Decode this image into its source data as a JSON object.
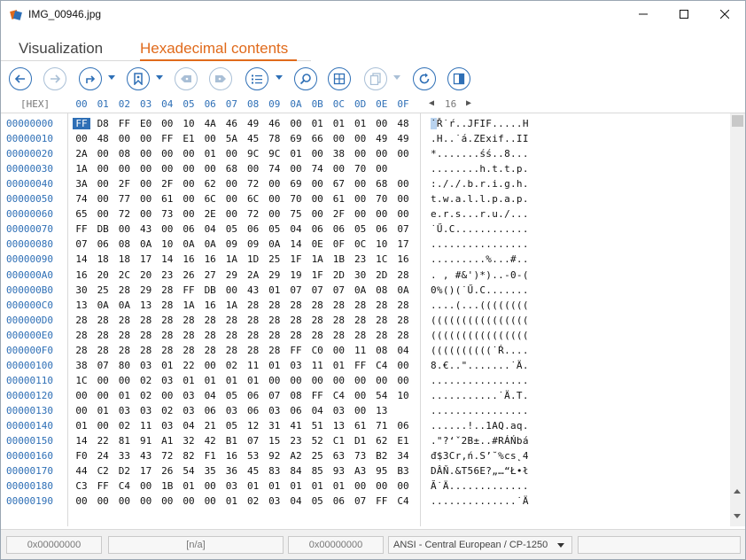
{
  "window": {
    "title": "IMG_00946.jpg"
  },
  "tabs": [
    {
      "label": "Visualization",
      "active": false
    },
    {
      "label": "Hexadecimal contents",
      "active": true
    }
  ],
  "colors": {
    "accent_orange": "#e06a1b",
    "accent_blue": "#2e6fb6",
    "selection": "#2e6fb6"
  },
  "toolbar": {
    "buttons": [
      {
        "name": "back-icon",
        "enabled": true
      },
      {
        "name": "forward-icon",
        "enabled": false
      },
      {
        "name": "redirect-icon",
        "enabled": true,
        "dropdown": true
      },
      {
        "name": "bookmark-icon",
        "enabled": true,
        "dropdown": true
      },
      {
        "name": "prev-bookmark-icon",
        "enabled": false
      },
      {
        "name": "next-bookmark-icon",
        "enabled": false
      },
      {
        "name": "list-icon",
        "enabled": true,
        "dropdown": true
      },
      {
        "name": "search-icon",
        "enabled": true
      },
      {
        "name": "grid-icon",
        "enabled": true
      },
      {
        "name": "copy-icon",
        "enabled": false,
        "dropdown": true
      },
      {
        "name": "refresh-icon",
        "enabled": true
      },
      {
        "name": "panel-icon",
        "enabled": true
      }
    ]
  },
  "hex": {
    "header_label": "[HEX]",
    "columns": [
      "00",
      "01",
      "02",
      "03",
      "04",
      "05",
      "06",
      "07",
      "08",
      "09",
      "0A",
      "0B",
      "0C",
      "0D",
      "0E",
      "0F"
    ],
    "page_number": "16",
    "selected_byte": {
      "row": 0,
      "col": 0
    },
    "rows": [
      {
        "offset": "00000000",
        "bytes": [
          "FF",
          "D8",
          "FF",
          "E0",
          "00",
          "10",
          "4A",
          "46",
          "49",
          "46",
          "00",
          "01",
          "01",
          "01",
          "00",
          "48"
        ],
        "text": "˙Ř˙ŕ..JFIF.....H"
      },
      {
        "offset": "00000010",
        "bytes": [
          "00",
          "48",
          "00",
          "00",
          "FF",
          "E1",
          "00",
          "5A",
          "45",
          "78",
          "69",
          "66",
          "00",
          "00",
          "49",
          "49"
        ],
        "text": ".H..˙á.ZExif..II"
      },
      {
        "offset": "00000020",
        "bytes": [
          "2A",
          "00",
          "08",
          "00",
          "00",
          "00",
          "01",
          "00",
          "9C",
          "9C",
          "01",
          "00",
          "38",
          "00",
          "00",
          "00"
        ],
        "text": "*.......śś..8..."
      },
      {
        "offset": "00000030",
        "bytes": [
          "1A",
          "00",
          "00",
          "00",
          "00",
          "00",
          "00",
          "68",
          "00",
          "74",
          "00",
          "74",
          "00",
          "70",
          "00"
        ],
        "text": "........h.t.t.p."
      },
      {
        "offset": "00000040",
        "bytes": [
          "3A",
          "00",
          "2F",
          "00",
          "2F",
          "00",
          "62",
          "00",
          "72",
          "00",
          "69",
          "00",
          "67",
          "00",
          "68",
          "00"
        ],
        "text": ":././.b.r.i.g.h."
      },
      {
        "offset": "00000050",
        "bytes": [
          "74",
          "00",
          "77",
          "00",
          "61",
          "00",
          "6C",
          "00",
          "6C",
          "00",
          "70",
          "00",
          "61",
          "00",
          "70",
          "00"
        ],
        "text": "t.w.a.l.l.p.a.p."
      },
      {
        "offset": "00000060",
        "bytes": [
          "65",
          "00",
          "72",
          "00",
          "73",
          "00",
          "2E",
          "00",
          "72",
          "00",
          "75",
          "00",
          "2F",
          "00",
          "00",
          "00"
        ],
        "text": "e.r.s...r.u./..."
      },
      {
        "offset": "00000070",
        "bytes": [
          "FF",
          "DB",
          "00",
          "43",
          "00",
          "06",
          "04",
          "05",
          "06",
          "05",
          "04",
          "06",
          "06",
          "05",
          "06",
          "07"
        ],
        "text": "˙Ű.C............"
      },
      {
        "offset": "00000080",
        "bytes": [
          "07",
          "06",
          "08",
          "0A",
          "10",
          "0A",
          "0A",
          "09",
          "09",
          "0A",
          "14",
          "0E",
          "0F",
          "0C",
          "10",
          "17"
        ],
        "text": "................"
      },
      {
        "offset": "00000090",
        "bytes": [
          "14",
          "18",
          "18",
          "17",
          "14",
          "16",
          "16",
          "1A",
          "1D",
          "25",
          "1F",
          "1A",
          "1B",
          "23",
          "1C",
          "16"
        ],
        "text": ".........%...#.."
      },
      {
        "offset": "000000A0",
        "bytes": [
          "16",
          "20",
          "2C",
          "20",
          "23",
          "26",
          "27",
          "29",
          "2A",
          "29",
          "19",
          "1F",
          "2D",
          "30",
          "2D",
          "28"
        ],
        "text": ". , #&')*)..-0-("
      },
      {
        "offset": "000000B0",
        "bytes": [
          "30",
          "25",
          "28",
          "29",
          "28",
          "FF",
          "DB",
          "00",
          "43",
          "01",
          "07",
          "07",
          "07",
          "0A",
          "08",
          "0A"
        ],
        "text": "0%()(˙Ű.C......."
      },
      {
        "offset": "000000C0",
        "bytes": [
          "13",
          "0A",
          "0A",
          "13",
          "28",
          "1A",
          "16",
          "1A",
          "28",
          "28",
          "28",
          "28",
          "28",
          "28",
          "28",
          "28"
        ],
        "text": "....(...(((((((("
      },
      {
        "offset": "000000D0",
        "bytes": [
          "28",
          "28",
          "28",
          "28",
          "28",
          "28",
          "28",
          "28",
          "28",
          "28",
          "28",
          "28",
          "28",
          "28",
          "28",
          "28"
        ],
        "text": "(((((((((((((((("
      },
      {
        "offset": "000000E0",
        "bytes": [
          "28",
          "28",
          "28",
          "28",
          "28",
          "28",
          "28",
          "28",
          "28",
          "28",
          "28",
          "28",
          "28",
          "28",
          "28",
          "28"
        ],
        "text": "(((((((((((((((("
      },
      {
        "offset": "000000F0",
        "bytes": [
          "28",
          "28",
          "28",
          "28",
          "28",
          "28",
          "28",
          "28",
          "28",
          "28",
          "FF",
          "C0",
          "00",
          "11",
          "08",
          "04"
        ],
        "text": "((((((((((˙Ŕ...."
      },
      {
        "offset": "00000100",
        "bytes": [
          "38",
          "07",
          "80",
          "03",
          "01",
          "22",
          "00",
          "02",
          "11",
          "01",
          "03",
          "11",
          "01",
          "FF",
          "C4",
          "00"
        ],
        "text": "8.€..\".......˙Ä."
      },
      {
        "offset": "00000110",
        "bytes": [
          "1C",
          "00",
          "00",
          "02",
          "03",
          "01",
          "01",
          "01",
          "01",
          "00",
          "00",
          "00",
          "00",
          "00",
          "00",
          "00"
        ],
        "text": "................"
      },
      {
        "offset": "00000120",
        "bytes": [
          "00",
          "00",
          "01",
          "02",
          "00",
          "03",
          "04",
          "05",
          "06",
          "07",
          "08",
          "FF",
          "C4",
          "00",
          "54",
          "10"
        ],
        "text": "...........˙Ä.T."
      },
      {
        "offset": "00000130",
        "bytes": [
          "00",
          "01",
          "03",
          "03",
          "02",
          "03",
          "06",
          "03",
          "06",
          "03",
          "06",
          "04",
          "03",
          "00",
          "13"
        ],
        "text": "................"
      },
      {
        "offset": "00000140",
        "bytes": [
          "01",
          "00",
          "02",
          "11",
          "03",
          "04",
          "21",
          "05",
          "12",
          "31",
          "41",
          "51",
          "13",
          "61",
          "71",
          "06"
        ],
        "text": "......!..1AQ.aq."
      },
      {
        "offset": "00000150",
        "bytes": [
          "14",
          "22",
          "81",
          "91",
          "A1",
          "32",
          "42",
          "B1",
          "07",
          "15",
          "23",
          "52",
          "C1",
          "D1",
          "62",
          "E1"
        ],
        "text": ".\"?‘ˇ2B±..#RÁŃbá"
      },
      {
        "offset": "00000160",
        "bytes": [
          "F0",
          "24",
          "33",
          "43",
          "72",
          "82",
          "F1",
          "16",
          "53",
          "92",
          "A2",
          "25",
          "63",
          "73",
          "B2",
          "34"
        ],
        "text": "đ$3Cr‚ń.S’˘%cs˛4"
      },
      {
        "offset": "00000170",
        "bytes": [
          "44",
          "C2",
          "D2",
          "17",
          "26",
          "54",
          "35",
          "36",
          "45",
          "83",
          "84",
          "85",
          "93",
          "A3",
          "95",
          "B3"
        ],
        "text": "DÂŇ.&T56E?„…“Ł•ł"
      },
      {
        "offset": "00000180",
        "bytes": [
          "C3",
          "FF",
          "C4",
          "00",
          "1B",
          "01",
          "00",
          "03",
          "01",
          "01",
          "01",
          "01",
          "01",
          "00",
          "00",
          "00"
        ],
        "text": "Ă˙Ä............."
      },
      {
        "offset": "00000190",
        "bytes": [
          "00",
          "00",
          "00",
          "00",
          "00",
          "00",
          "00",
          "01",
          "02",
          "03",
          "04",
          "05",
          "06",
          "07",
          "FF",
          "C4"
        ],
        "text": "..............˙Ä"
      }
    ]
  },
  "statusbar": {
    "offset_start": "0x00000000",
    "selection_size": "[n/a]",
    "offset_end": "0x00000000",
    "encoding": "ANSI - Central European / CP-1250",
    "extra": ""
  }
}
